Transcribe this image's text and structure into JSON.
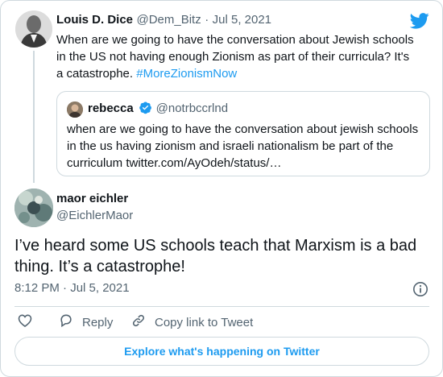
{
  "colors": {
    "accent": "#1d9bf0",
    "text": "#0f1419",
    "secondary": "#536471",
    "border": "#cfd9de"
  },
  "parent_tweet": {
    "display_name": "Louis D. Dice",
    "handle": "@Dem_Bitz",
    "separator": "·",
    "date": "Jul 5, 2021",
    "text": "When are we going to have the conversation about Jewish schools in the US not having enough Zionism as part of their curricula? It's a catastrophe. ",
    "hashtag": "#MoreZionismNow",
    "brand_icon": "twitter-bird-icon"
  },
  "quoted_tweet": {
    "display_name": "rebecca",
    "verified_icon": "verified-badge-icon",
    "handle": "@notrbccrlnd",
    "text": "when are we going to have the conversation about jewish schools in the us having zionism and israeli nationalism be part of the curriculum twitter.com/AyOdeh/status/…"
  },
  "main_tweet": {
    "display_name": "maor eichler",
    "handle": "@EichlerMaor",
    "text": "I’ve heard some US schools teach that Marxism is a bad thing. It’s a catastrophe!",
    "timestamp": "8:12 PM · Jul 5, 2021",
    "info_icon": "info-icon"
  },
  "actions": {
    "like_icon": "heart-icon",
    "reply_label": "Reply",
    "reply_icon": "reply-icon",
    "copy_link_label": "Copy link to Tweet",
    "copy_link_icon": "link-icon"
  },
  "footer": {
    "explore_label": "Explore what's happening on Twitter"
  }
}
